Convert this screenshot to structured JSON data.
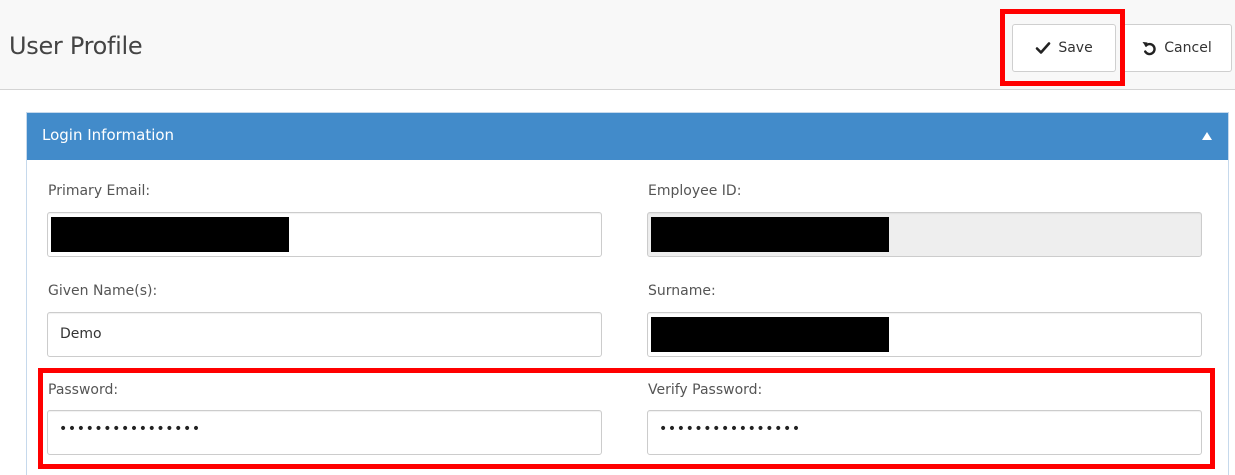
{
  "header": {
    "title": "User Profile",
    "save_label": "Save",
    "cancel_label": "Cancel"
  },
  "panel": {
    "title": "Login Information",
    "fields": {
      "primary_email": {
        "label": "Primary Email:",
        "value": ""
      },
      "employee_id": {
        "label": "Employee ID:",
        "value": ""
      },
      "given_names": {
        "label": "Given Name(s):",
        "value": "Demo"
      },
      "surname": {
        "label": "Surname:",
        "value": ""
      },
      "password": {
        "label": "Password:",
        "masked": "••••••••••••••••"
      },
      "verify_password": {
        "label": "Verify Password:",
        "masked": "••••••••••••••••"
      }
    }
  },
  "colors": {
    "panel_heading": "#428bca",
    "highlight": "#ff0000",
    "readonly_bg": "#eeeeee"
  },
  "icons": {
    "save": "check-icon",
    "cancel": "undo-icon",
    "collapse": "caret-up-icon"
  }
}
